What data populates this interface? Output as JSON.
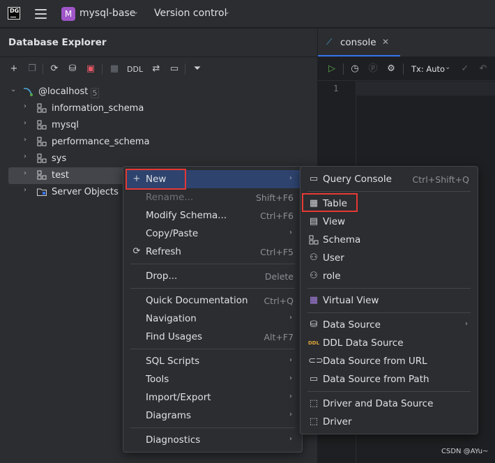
{
  "titlebar": {
    "logo_line1": "DG",
    "project_badge": "M",
    "project_name": "mysql-base",
    "vcs_label": "Version control"
  },
  "explorer": {
    "title": "Database Explorer",
    "toolbar": {
      "ddl_label": "DDL"
    },
    "tree": {
      "root": {
        "label": "@localhost",
        "count": "5"
      },
      "items": [
        {
          "label": "information_schema"
        },
        {
          "label": "mysql"
        },
        {
          "label": "performance_schema"
        },
        {
          "label": "sys"
        },
        {
          "label": "test"
        },
        {
          "label": "Server Objects"
        }
      ]
    }
  },
  "editor": {
    "tab_label": "console",
    "tx_label": "Tx: Auto",
    "line_number": "1"
  },
  "context_menu": {
    "items": [
      {
        "label": "New"
      },
      {
        "label": "Rename...",
        "shortcut": "Shift+F6"
      },
      {
        "label": "Modify Schema...",
        "shortcut": "Ctrl+F6"
      },
      {
        "label": "Copy/Paste"
      },
      {
        "label": "Refresh",
        "shortcut": "Ctrl+F5"
      },
      {
        "label": "Drop...",
        "shortcut": "Delete"
      },
      {
        "label": "Quick Documentation",
        "shortcut": "Ctrl+Q"
      },
      {
        "label": "Navigation"
      },
      {
        "label": "Find Usages",
        "shortcut": "Alt+F7"
      },
      {
        "label": "SQL Scripts"
      },
      {
        "label": "Tools"
      },
      {
        "label": "Import/Export"
      },
      {
        "label": "Diagrams"
      },
      {
        "label": "Diagnostics"
      }
    ]
  },
  "submenu": {
    "items": [
      {
        "label": "Query Console",
        "shortcut": "Ctrl+Shift+Q"
      },
      {
        "label": "Table"
      },
      {
        "label": "View"
      },
      {
        "label": "Schema"
      },
      {
        "label": "User"
      },
      {
        "label": "role"
      },
      {
        "label": "Virtual View"
      },
      {
        "label": "Data Source"
      },
      {
        "label": "DDL Data Source"
      },
      {
        "label": "Data Source from URL"
      },
      {
        "label": "Data Source from Path"
      },
      {
        "label": "Driver and Data Source"
      },
      {
        "label": "Driver"
      }
    ]
  },
  "watermark": "CSDN @AYu~",
  "colors": {
    "highlight": "#2e436e",
    "accent": "#3574f0",
    "annotation": "#e53935",
    "run": "#57a64a"
  }
}
